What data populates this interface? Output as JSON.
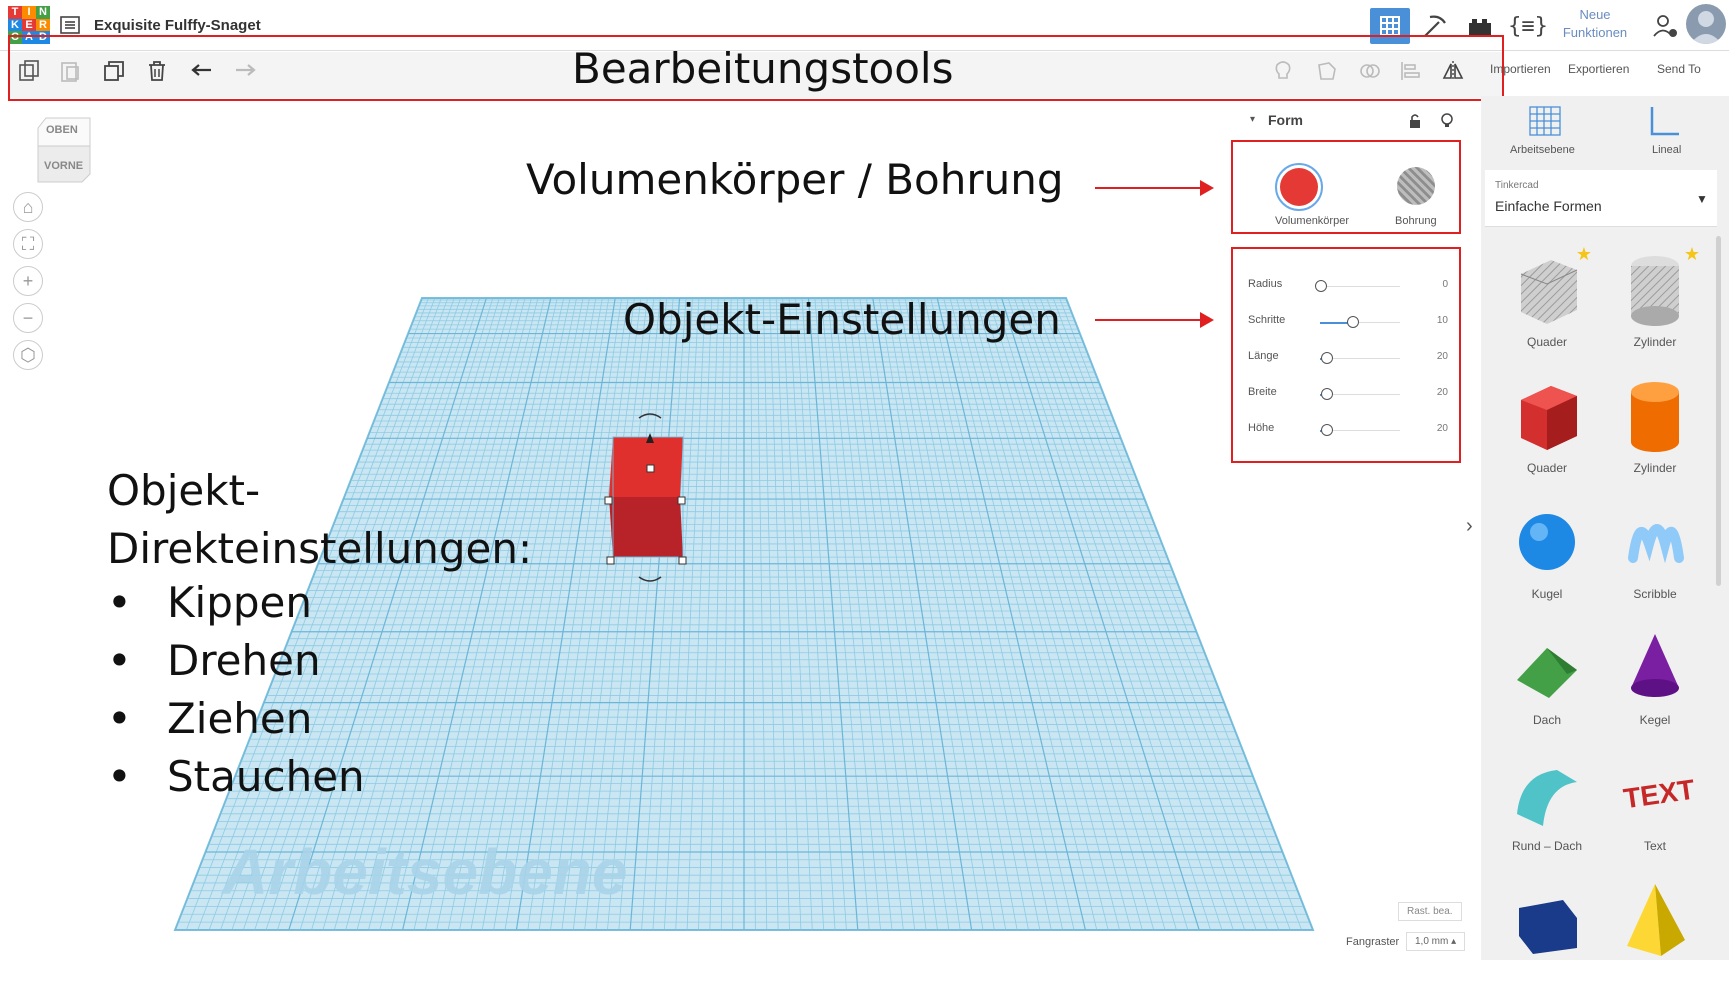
{
  "app": {
    "logo_letters": [
      "T",
      "I",
      "N",
      "K",
      "E",
      "R",
      "C",
      "A",
      "D"
    ],
    "logo_colors": [
      "#e53935",
      "#fb8c00",
      "#43a047",
      "#1e88e5",
      "#e53935",
      "#fb8c00",
      "#43a047",
      "#1e88e5",
      "#1e88e5"
    ],
    "design_title": "Exquisite Fulffy-Snaget",
    "new_features": "Neue Funktionen"
  },
  "top_actions": {
    "import": "Importieren",
    "export": "Exportieren",
    "send_to": "Send To"
  },
  "toolbar": {
    "caption": "Bearbeitungstools",
    "tools": [
      "copy-icon",
      "paste-icon",
      "duplicate-icon",
      "delete-icon",
      "undo-icon",
      "redo-icon"
    ]
  },
  "viewcube": {
    "top": "OBEN",
    "front": "VORNE"
  },
  "annotations": {
    "solid_hole": "Volumenkörper / Bohrung",
    "object_settings": "Objekt-Einstellungen",
    "direct_title_1": "Objekt-",
    "direct_title_2": "Direkteinstellungen:",
    "direct_items": [
      "Kippen",
      "Drehen",
      "Ziehen",
      "Stauchen"
    ]
  },
  "workplane_label": "Arbeitsebene",
  "inspector": {
    "header": "Form",
    "solid_label": "Volumenkörper",
    "hole_label": "Bohrung",
    "properties": [
      {
        "label": "Radius",
        "value": "0",
        "level": 0
      },
      {
        "label": "Schritte",
        "value": "10",
        "level": 0.4
      },
      {
        "label": "Länge",
        "value": "20",
        "level": 0.08
      },
      {
        "label": "Breite",
        "value": "20",
        "level": 0.08
      },
      {
        "label": "Höhe",
        "value": "20",
        "level": 0.08
      }
    ]
  },
  "bottom_right": {
    "edit_grid": "Rast. bea.",
    "snap_label": "Fangraster",
    "snap_value": "1,0 mm"
  },
  "right_panel": {
    "workplane": "Arbeitsebene",
    "ruler": "Lineal",
    "library_small": "Tinkercad",
    "library": "Einfache Formen",
    "shapes": [
      {
        "name": "Quader",
        "kind": "box-hole",
        "color": "#b0b0b0"
      },
      {
        "name": "Zylinder",
        "kind": "cyl-hole",
        "color": "#b0b0b0"
      },
      {
        "name": "Quader",
        "kind": "box",
        "color": "#d32f2f"
      },
      {
        "name": "Zylinder",
        "kind": "cyl",
        "color": "#ef6c00"
      },
      {
        "name": "Kugel",
        "kind": "sphere",
        "color": "#1e88e5"
      },
      {
        "name": "Scribble",
        "kind": "scribble",
        "color": "#90caf9"
      },
      {
        "name": "Dach",
        "kind": "roof",
        "color": "#43a047"
      },
      {
        "name": "Kegel",
        "kind": "cone",
        "color": "#7b1fa2"
      },
      {
        "name": "Rund – Dach",
        "kind": "roundroof",
        "color": "#4fc3c8"
      },
      {
        "name": "Text",
        "kind": "text",
        "color": "#c62828"
      },
      {
        "name": "",
        "kind": "prism",
        "color": "#1a3a8a"
      },
      {
        "name": "",
        "kind": "pyramid",
        "color": "#fdd835"
      }
    ]
  }
}
